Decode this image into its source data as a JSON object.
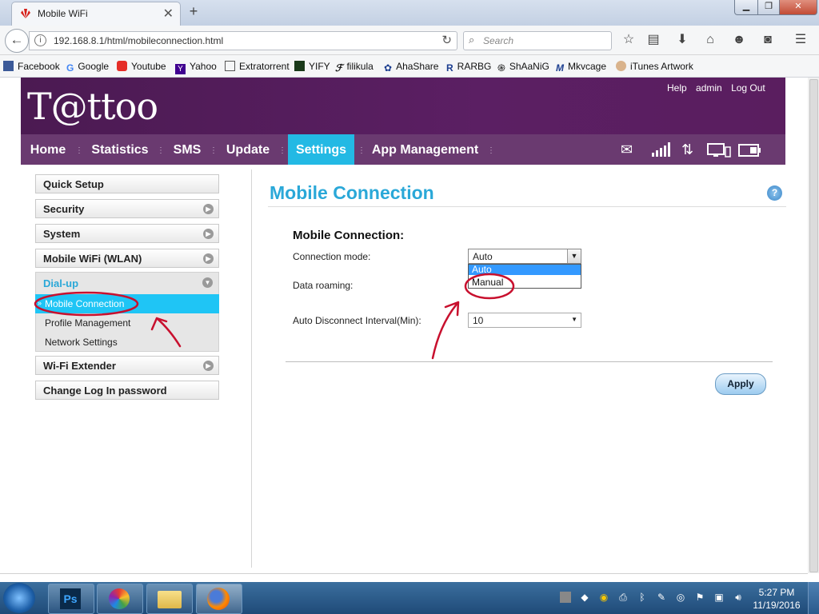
{
  "browser": {
    "tab_title": "Mobile WiFi",
    "tab_close": "✕",
    "new_tab": "+",
    "url": "192.168.8.1/html/mobileconnection.html",
    "search_placeholder": "Search",
    "bookmarks": [
      "Facebook",
      "Google",
      "Youtube",
      "Yahoo",
      "Extratorrent",
      "YIFY",
      "filikula",
      "AhaShare",
      "RARBG",
      "ShAaNiG",
      "Mkvcage",
      "iTunes Artwork"
    ]
  },
  "header": {
    "logo": "T@ttoo",
    "links": [
      "Help",
      "admin",
      "Log Out"
    ]
  },
  "menu": {
    "items": [
      "Home",
      "Statistics",
      "SMS",
      "Update",
      "Settings",
      "App Management"
    ],
    "active": "Settings"
  },
  "sidebar": {
    "items": [
      "Quick Setup",
      "Security",
      "System",
      "Mobile WiFi (WLAN)",
      "Dial-up",
      "Wi-Fi Extender",
      "Change Log In password"
    ],
    "dialup_sub": [
      "Mobile Connection",
      "Profile Management",
      "Network Settings"
    ],
    "selected": "Mobile Connection"
  },
  "main": {
    "title": "Mobile Connection",
    "form_title": "Mobile Connection:",
    "connection_mode_label": "Connection mode:",
    "connection_mode_value": "Auto",
    "connection_mode_options": [
      "Auto",
      "Manual"
    ],
    "data_roaming_label": "Data roaming:",
    "auto_disconnect_label": "Auto Disconnect Interval(Min):",
    "auto_disconnect_value": "10",
    "apply_label": "Apply",
    "help_glyph": "?"
  },
  "taskbar": {
    "time": "5:27 PM",
    "date": "11/19/2016"
  },
  "colors": {
    "header_purple": "#5b1f63",
    "menu_purple": "#6a3a70",
    "accent_cyan": "#23b9e4",
    "title_blue": "#2aa8d8",
    "annotation_red": "#c8102e"
  }
}
